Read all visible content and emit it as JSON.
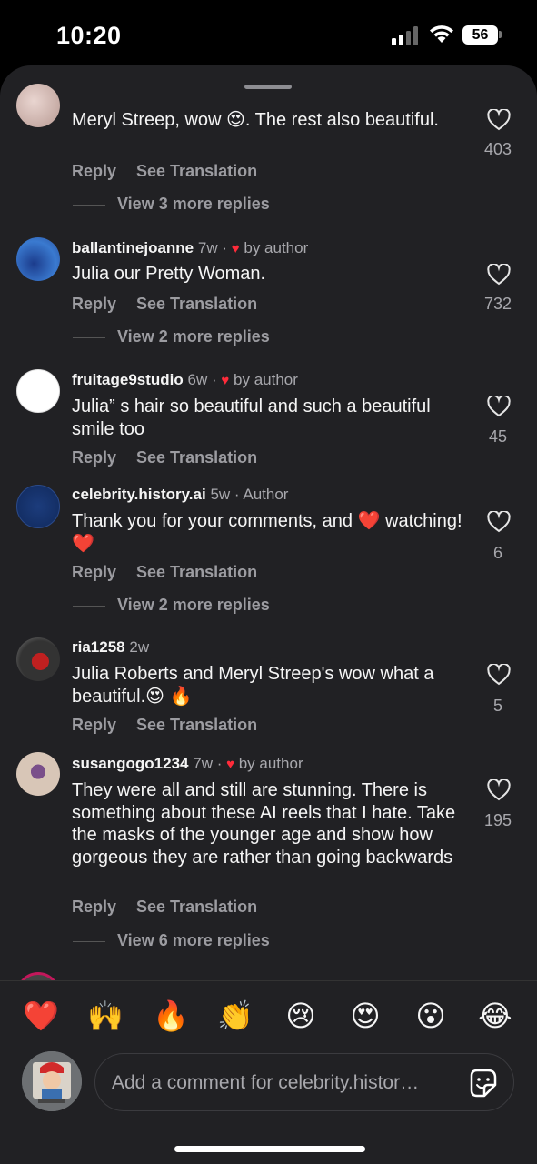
{
  "status": {
    "time": "10:20",
    "battery": "56"
  },
  "comments": [
    {
      "username": "",
      "text": "Meryl Streep, wow 😍. The rest also beautiful.",
      "reply": "Reply",
      "translate": "See Translation",
      "likes": "403",
      "view_replies": "View 3 more replies"
    },
    {
      "username": "ballantinejoanne",
      "age": "7w",
      "tag": "by author",
      "text": "Julia our Pretty Woman.",
      "reply": "Reply",
      "translate": "See Translation",
      "likes": "732",
      "view_replies": "View 2 more replies"
    },
    {
      "username": "fruitage9studio",
      "age": "6w",
      "tag": "by author",
      "text": "Julia” s hair so beautiful and such a beautiful smile too",
      "reply": "Reply",
      "translate": "See Translation",
      "likes": "45"
    },
    {
      "username": "celebrity.history.ai",
      "age": "5w",
      "tag": "Author",
      "text": "Thank you for your comments, and ❤️ watching!❤️",
      "reply": "Reply",
      "translate": "See Translation",
      "likes": "6",
      "view_replies": "View 2 more replies"
    },
    {
      "username": "ria1258",
      "age": "2w",
      "text": "Julia Roberts and Meryl Streep's wow what a beautiful.😍 🔥",
      "reply": "Reply",
      "translate": "See Translation",
      "likes": "5"
    },
    {
      "username": "susangogo1234",
      "age": "7w",
      "tag": "by author",
      "text": "They were all and still are stunning. There is something about these AI  reels that I hate.  Take the masks of the younger age and show how gorgeous they are rather than going backwards",
      "reply": "Reply",
      "translate": "See Translation",
      "likes": "195",
      "view_replies": "View 6 more replies"
    }
  ],
  "emoji_bar": [
    "❤️",
    "🙌",
    "🔥",
    "👏",
    "😢",
    "😍",
    "😮",
    "😂"
  ],
  "composer": {
    "placeholder": "Add a comment for celebrity.histor…"
  },
  "colors": {
    "background": "#212124",
    "heart": "#ff2b3a",
    "muted": "#a8a8ad"
  }
}
